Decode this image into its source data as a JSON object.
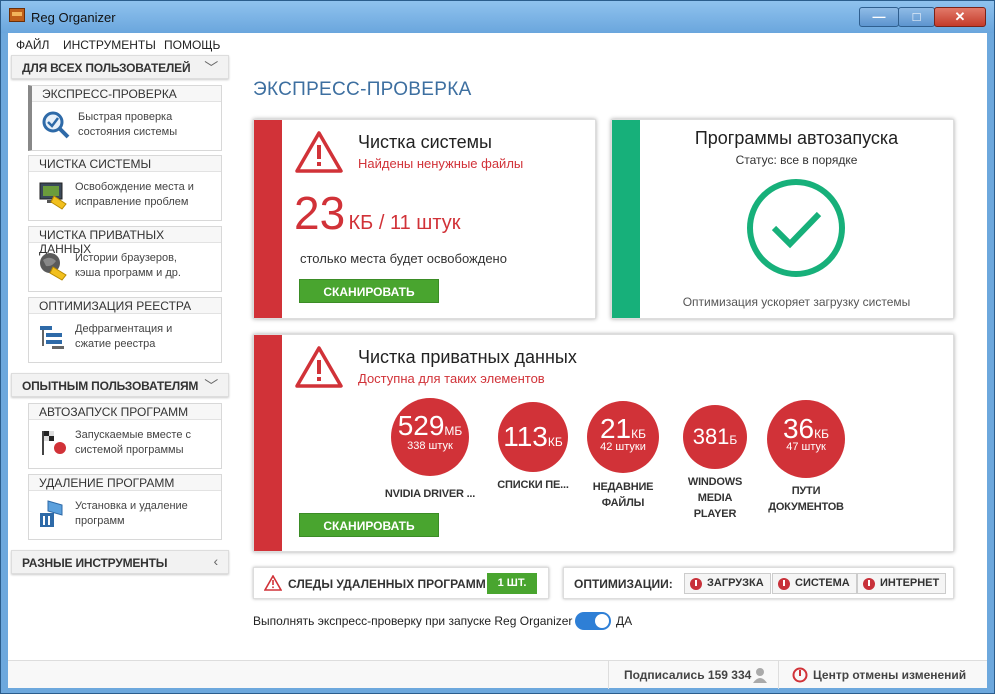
{
  "window": {
    "title": "Reg Organizer"
  },
  "menu": [
    "ФАЙЛ",
    "ИНСТРУМЕНТЫ",
    "ПОМОЩЬ"
  ],
  "sidebar": {
    "all_users": "ДЛЯ ВСЕХ ПОЛЬЗОВАТЕЛЕЙ",
    "experienced": "ОПЫТНЫМ ПОЛЬЗОВАТЕЛЯМ",
    "misc": "РАЗНЫЕ ИНСТРУМЕНТЫ",
    "items": [
      {
        "title": "ЭКСПРЕСС-ПРОВЕРКА",
        "desc1": "Быстрая проверка",
        "desc2": "состояния системы",
        "icon": "magnifier-check-icon"
      },
      {
        "title": "ЧИСТКА СИСТЕМЫ",
        "desc1": "Освобождение места и",
        "desc2": "исправление проблем",
        "icon": "monitor-broom-icon"
      },
      {
        "title": "ЧИСТКА ПРИВАТНЫХ ДАННЫХ",
        "desc1": "Истории браузеров,",
        "desc2": "кэша программ и др.",
        "icon": "globe-broom-icon"
      },
      {
        "title": "ОПТИМИЗАЦИЯ РЕЕСТРА",
        "desc1": "Дефрагментация и",
        "desc2": "сжатие реестра",
        "icon": "registry-icon"
      },
      {
        "title": "АВТОЗАПУСК ПРОГРАММ",
        "desc1": "Запускаемые вместе с",
        "desc2": "системой программы",
        "icon": "checkered-flag-icon"
      },
      {
        "title": "УДАЛЕНИЕ ПРОГРАММ",
        "desc1": "Установка и удаление",
        "desc2": "программ",
        "icon": "package-trash-icon"
      }
    ]
  },
  "main": {
    "heading": "ЭКСПРЕСС-ПРОВЕРКА",
    "system_clean": {
      "title": "Чистка системы",
      "subtitle": "Найдены ненужные файлы",
      "amount": "23",
      "amount_unit": "КБ / 11 штук",
      "note": "столько места будет освобождено",
      "button": "СКАНИРОВАТЬ"
    },
    "autorun": {
      "title": "Программы автозапуска",
      "status": "Статус: все в порядке",
      "note": "Оптимизация ускоряет загрузку системы"
    },
    "private": {
      "title": "Чистка приватных данных",
      "subtitle": "Доступна для таких элементов",
      "button": "СКАНИРОВАТЬ",
      "items": [
        {
          "value": "529",
          "unit": "МБ",
          "sub": "338 штук",
          "label": "NVIDIA DRIVER ..."
        },
        {
          "value": "113",
          "unit": "КБ",
          "sub": "",
          "label": "СПИСКИ ПЕ..."
        },
        {
          "value": "21",
          "unit": "КБ",
          "sub": "42 штуки",
          "label": "НЕДАВНИЕ ФАЙЛЫ"
        },
        {
          "value": "381",
          "unit": "Б",
          "sub": "",
          "label": "WINDOWS MEDIA PLAYER"
        },
        {
          "value": "36",
          "unit": "КБ",
          "sub": "47 штук",
          "label": "ПУТИ ДОКУМЕНТОВ"
        }
      ]
    },
    "traces": {
      "label": "СЛЕДЫ УДАЛЕННЫХ ПРОГРАММ",
      "count": "1 ШТ."
    },
    "optim": {
      "label": "ОПТИМИЗАЦИИ:",
      "tags": [
        "ЗАГРУЗКА",
        "СИСТЕМА",
        "ИНТЕРНЕТ"
      ]
    },
    "startup": {
      "label": "Выполнять экспресс-проверку при запуске Reg Organizer",
      "value": "ДА"
    }
  },
  "status": {
    "subscribed": "Подписались 159 334",
    "undo": "Центр отмены изменений"
  },
  "colors": {
    "red": "#d13238",
    "green": "#17b07a",
    "button": "#49a52f",
    "accent": "#3d6fa0"
  }
}
